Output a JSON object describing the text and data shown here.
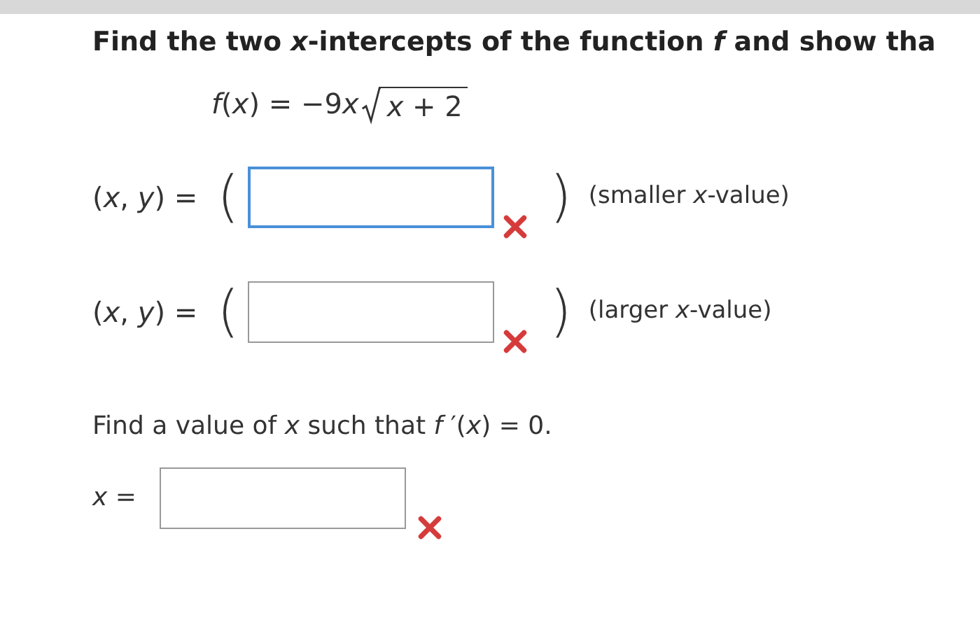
{
  "question": "Find the two *x*-intercepts of the function *f* and show tha",
  "formula": {
    "lhs": "*f*(*x*) = −9",
    "variable": "x",
    "radicand": "*x* + 2"
  },
  "intercepts": [
    {
      "label": "(*x*, *y*) =",
      "open": "(",
      "close": ")",
      "note": "(smaller *x*-value)",
      "focused": true,
      "correct": false
    },
    {
      "label": "(*x*, *y*) =",
      "open": "(",
      "close": ")",
      "note": "(larger *x*-value)",
      "focused": false,
      "correct": false
    }
  ],
  "part2": {
    "question": "Find a value of *x* such that *f* ′(*x*) = 0.",
    "label": "*x* =",
    "focused": false,
    "correct": false
  }
}
